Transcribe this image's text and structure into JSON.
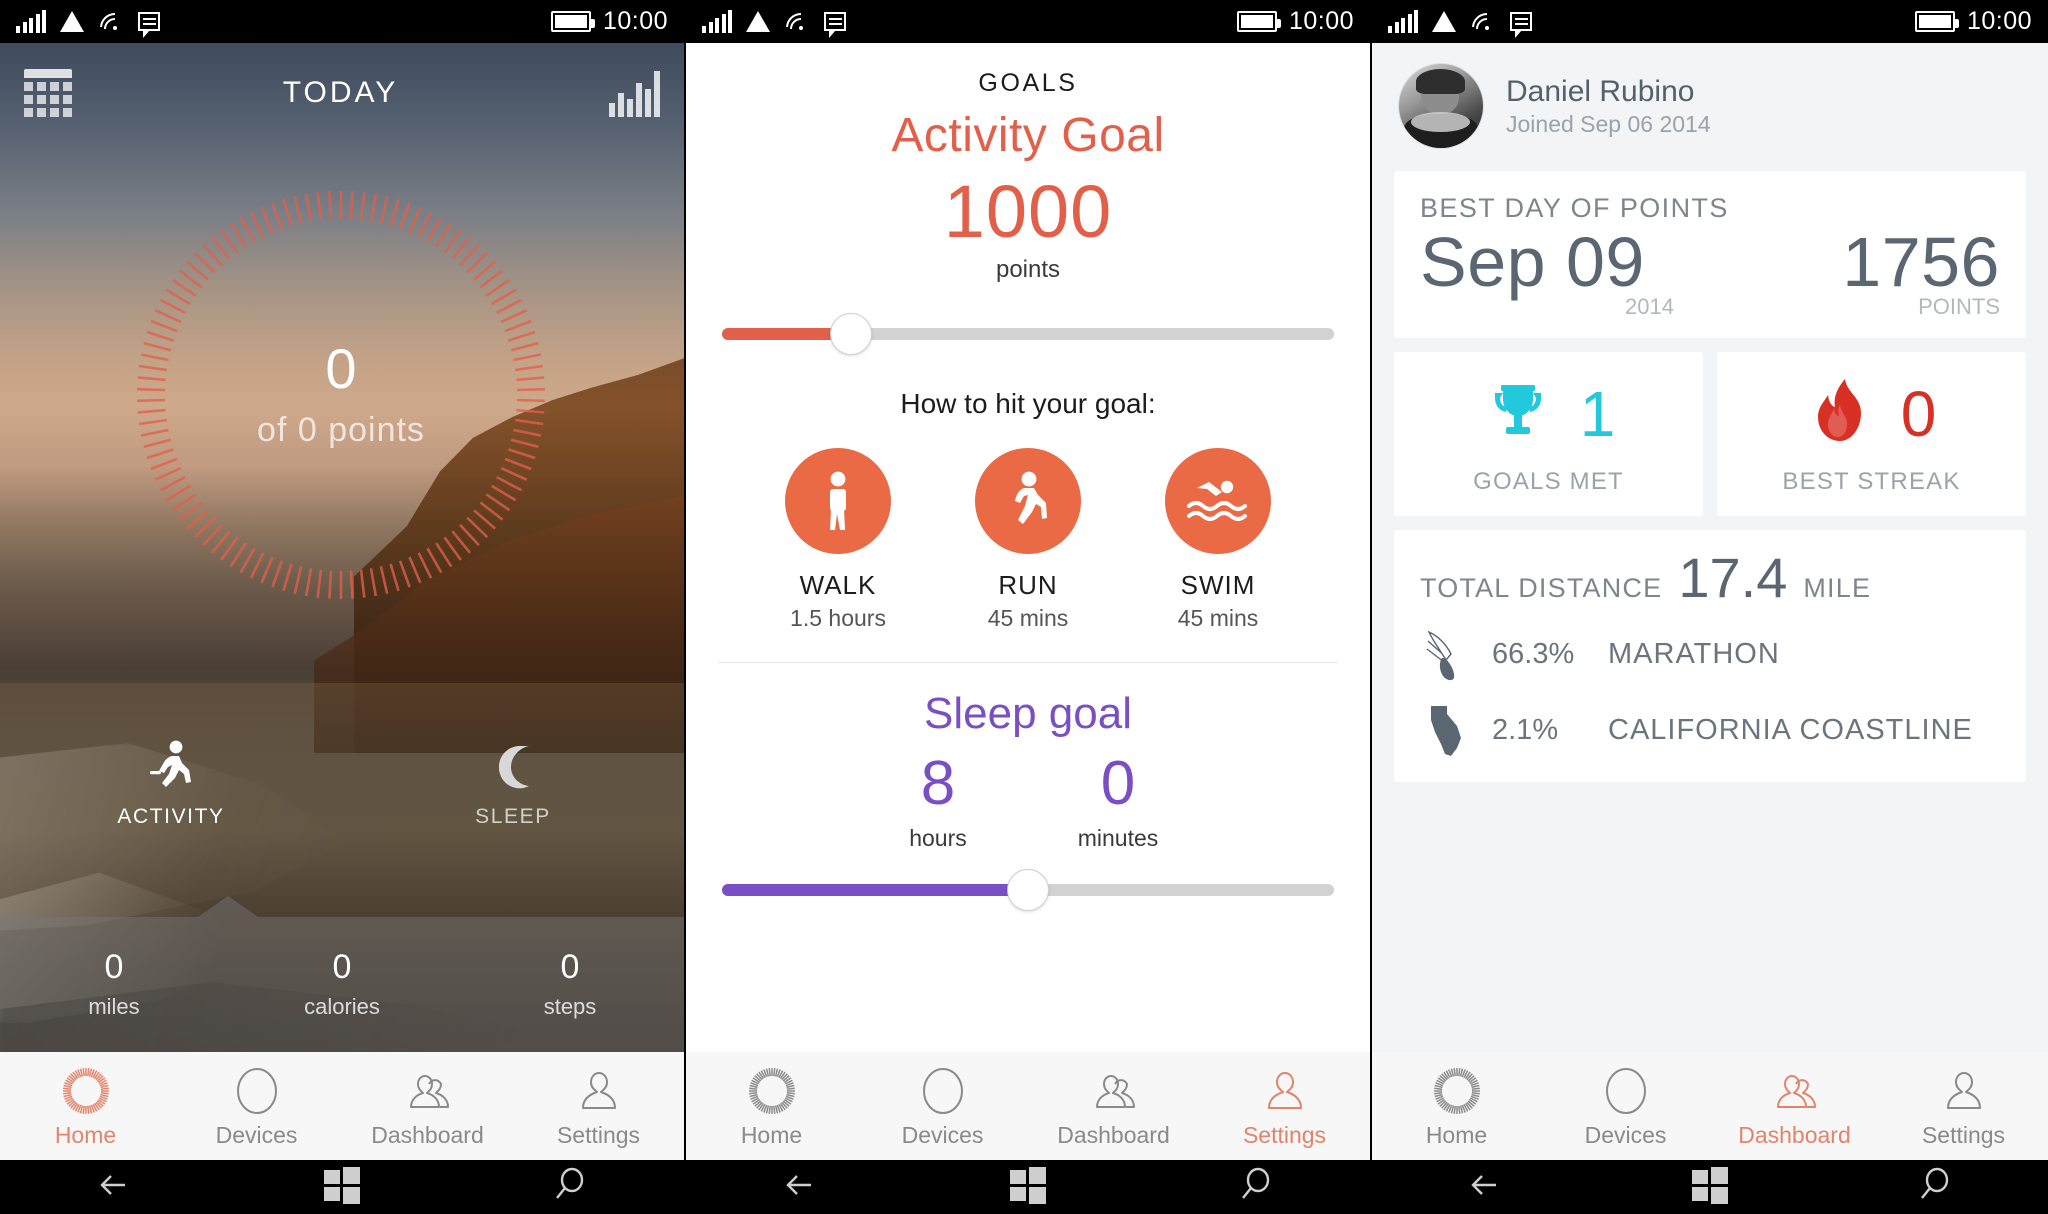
{
  "status_bar": {
    "time": "10:00",
    "icons": [
      "cellular-signal-icon",
      "triangle-icon",
      "wifi-icon",
      "message-icon",
      "battery-icon"
    ]
  },
  "panel_home": {
    "header": {
      "calendar_icon": "calendar-icon",
      "title": "TODAY",
      "chart_icon": "bar-chart-icon"
    },
    "gauge": {
      "value": "0",
      "subtitle": "of  0  points",
      "accent_color": "#e2604a",
      "progress_percent": 0
    },
    "modes": [
      {
        "label": "ACTIVITY",
        "icon": "running-person-icon",
        "active": true
      },
      {
        "label": "SLEEP",
        "icon": "moon-icon",
        "active": false
      }
    ],
    "stats": [
      {
        "value": "0",
        "label": "miles"
      },
      {
        "value": "0",
        "label": "calories"
      },
      {
        "value": "0",
        "label": "steps"
      }
    ]
  },
  "panel_goals": {
    "kicker": "GOALS",
    "goal_name": "Activity Goal",
    "goal_value": "1000",
    "goal_unit": "points",
    "activity_slider": {
      "percent": 21,
      "fill_color": "#e2604a"
    },
    "how_to_label": "How to hit your goal:",
    "activities": [
      {
        "name": "WALK",
        "duration": "1.5 hours",
        "icon": "walking-person-icon"
      },
      {
        "name": "RUN",
        "duration": "45 mins",
        "icon": "running-person-icon"
      },
      {
        "name": "SWIM",
        "duration": "45 mins",
        "icon": "swimmer-icon"
      }
    ],
    "sleep_title": "Sleep goal",
    "sleep_hours": {
      "value": "8",
      "label": "hours"
    },
    "sleep_minutes": {
      "value": "0",
      "label": "minutes"
    },
    "sleep_slider": {
      "percent": 50,
      "fill_color": "#7b4fc4"
    }
  },
  "panel_dashboard": {
    "profile": {
      "name": "Daniel Rubino",
      "joined": "Joined Sep 06 2014",
      "avatar": "user-avatar"
    },
    "best_day": {
      "label": "BEST DAY OF POINTS",
      "date": "Sep 09",
      "year": "2014",
      "points": "1756",
      "points_label": "POINTS"
    },
    "goals_met": {
      "value": "1",
      "label": "GOALS MET",
      "icon": "trophy-icon",
      "color": "#22c8dc"
    },
    "best_streak": {
      "value": "0",
      "label": "BEST STREAK",
      "icon": "flame-icon",
      "color": "#d93025"
    },
    "distance": {
      "label": "TOTAL DISTANCE",
      "value": "17.4",
      "unit": "MILE",
      "achievements": [
        {
          "percent": "66.3%",
          "name": "MARATHON",
          "icon": "winged-shoe-icon"
        },
        {
          "percent": "2.1%",
          "name": "CALIFORNIA COASTLINE",
          "icon": "california-icon"
        }
      ]
    }
  },
  "bottom_nav": {
    "items": [
      {
        "label": "Home",
        "icon": "radial-ring-icon"
      },
      {
        "label": "Devices",
        "icon": "circle-icon"
      },
      {
        "label": "Dashboard",
        "icon": "two-people-icon"
      },
      {
        "label": "Settings",
        "icon": "person-icon"
      }
    ],
    "active_panel_1": "Home",
    "active_panel_2": "Settings",
    "active_panel_3": "Dashboard",
    "active_color": "#e2846c"
  },
  "windows_nav": {
    "buttons": [
      {
        "name": "back",
        "icon": "back-arrow-icon"
      },
      {
        "name": "start",
        "icon": "windows-logo-icon"
      },
      {
        "name": "search",
        "icon": "search-icon"
      }
    ]
  }
}
